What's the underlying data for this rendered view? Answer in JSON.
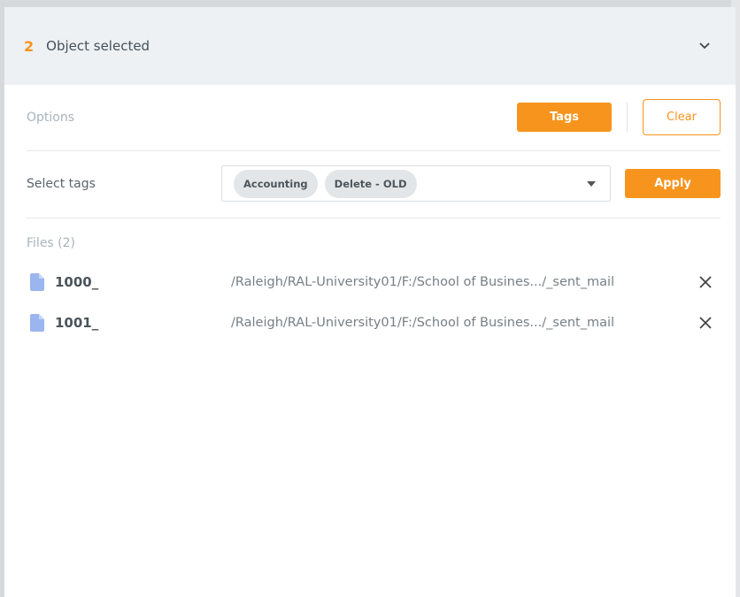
{
  "header": {
    "count": "2",
    "title": "Object selected",
    "expand_icon": "chevron-down-icon"
  },
  "options": {
    "label": "Options",
    "tags_button": "Tags",
    "clear_button": "Clear"
  },
  "tags": {
    "label": "Select tags",
    "selected": [
      "Accounting",
      "Delete - OLD"
    ],
    "apply_button": "Apply"
  },
  "files": {
    "title": "Files (2)",
    "items": [
      {
        "name": "1000_",
        "path": "/Raleigh/RAL-University01/F:/School of Busines.../_sent_mail"
      },
      {
        "name": "1001_",
        "path": "/Raleigh/RAL-University01/F:/School of Busines.../_sent_mail"
      }
    ]
  },
  "colors": {
    "accent": "#f7941d",
    "header_bg": "#edf1f4",
    "file_icon": "#9bb6ee"
  }
}
